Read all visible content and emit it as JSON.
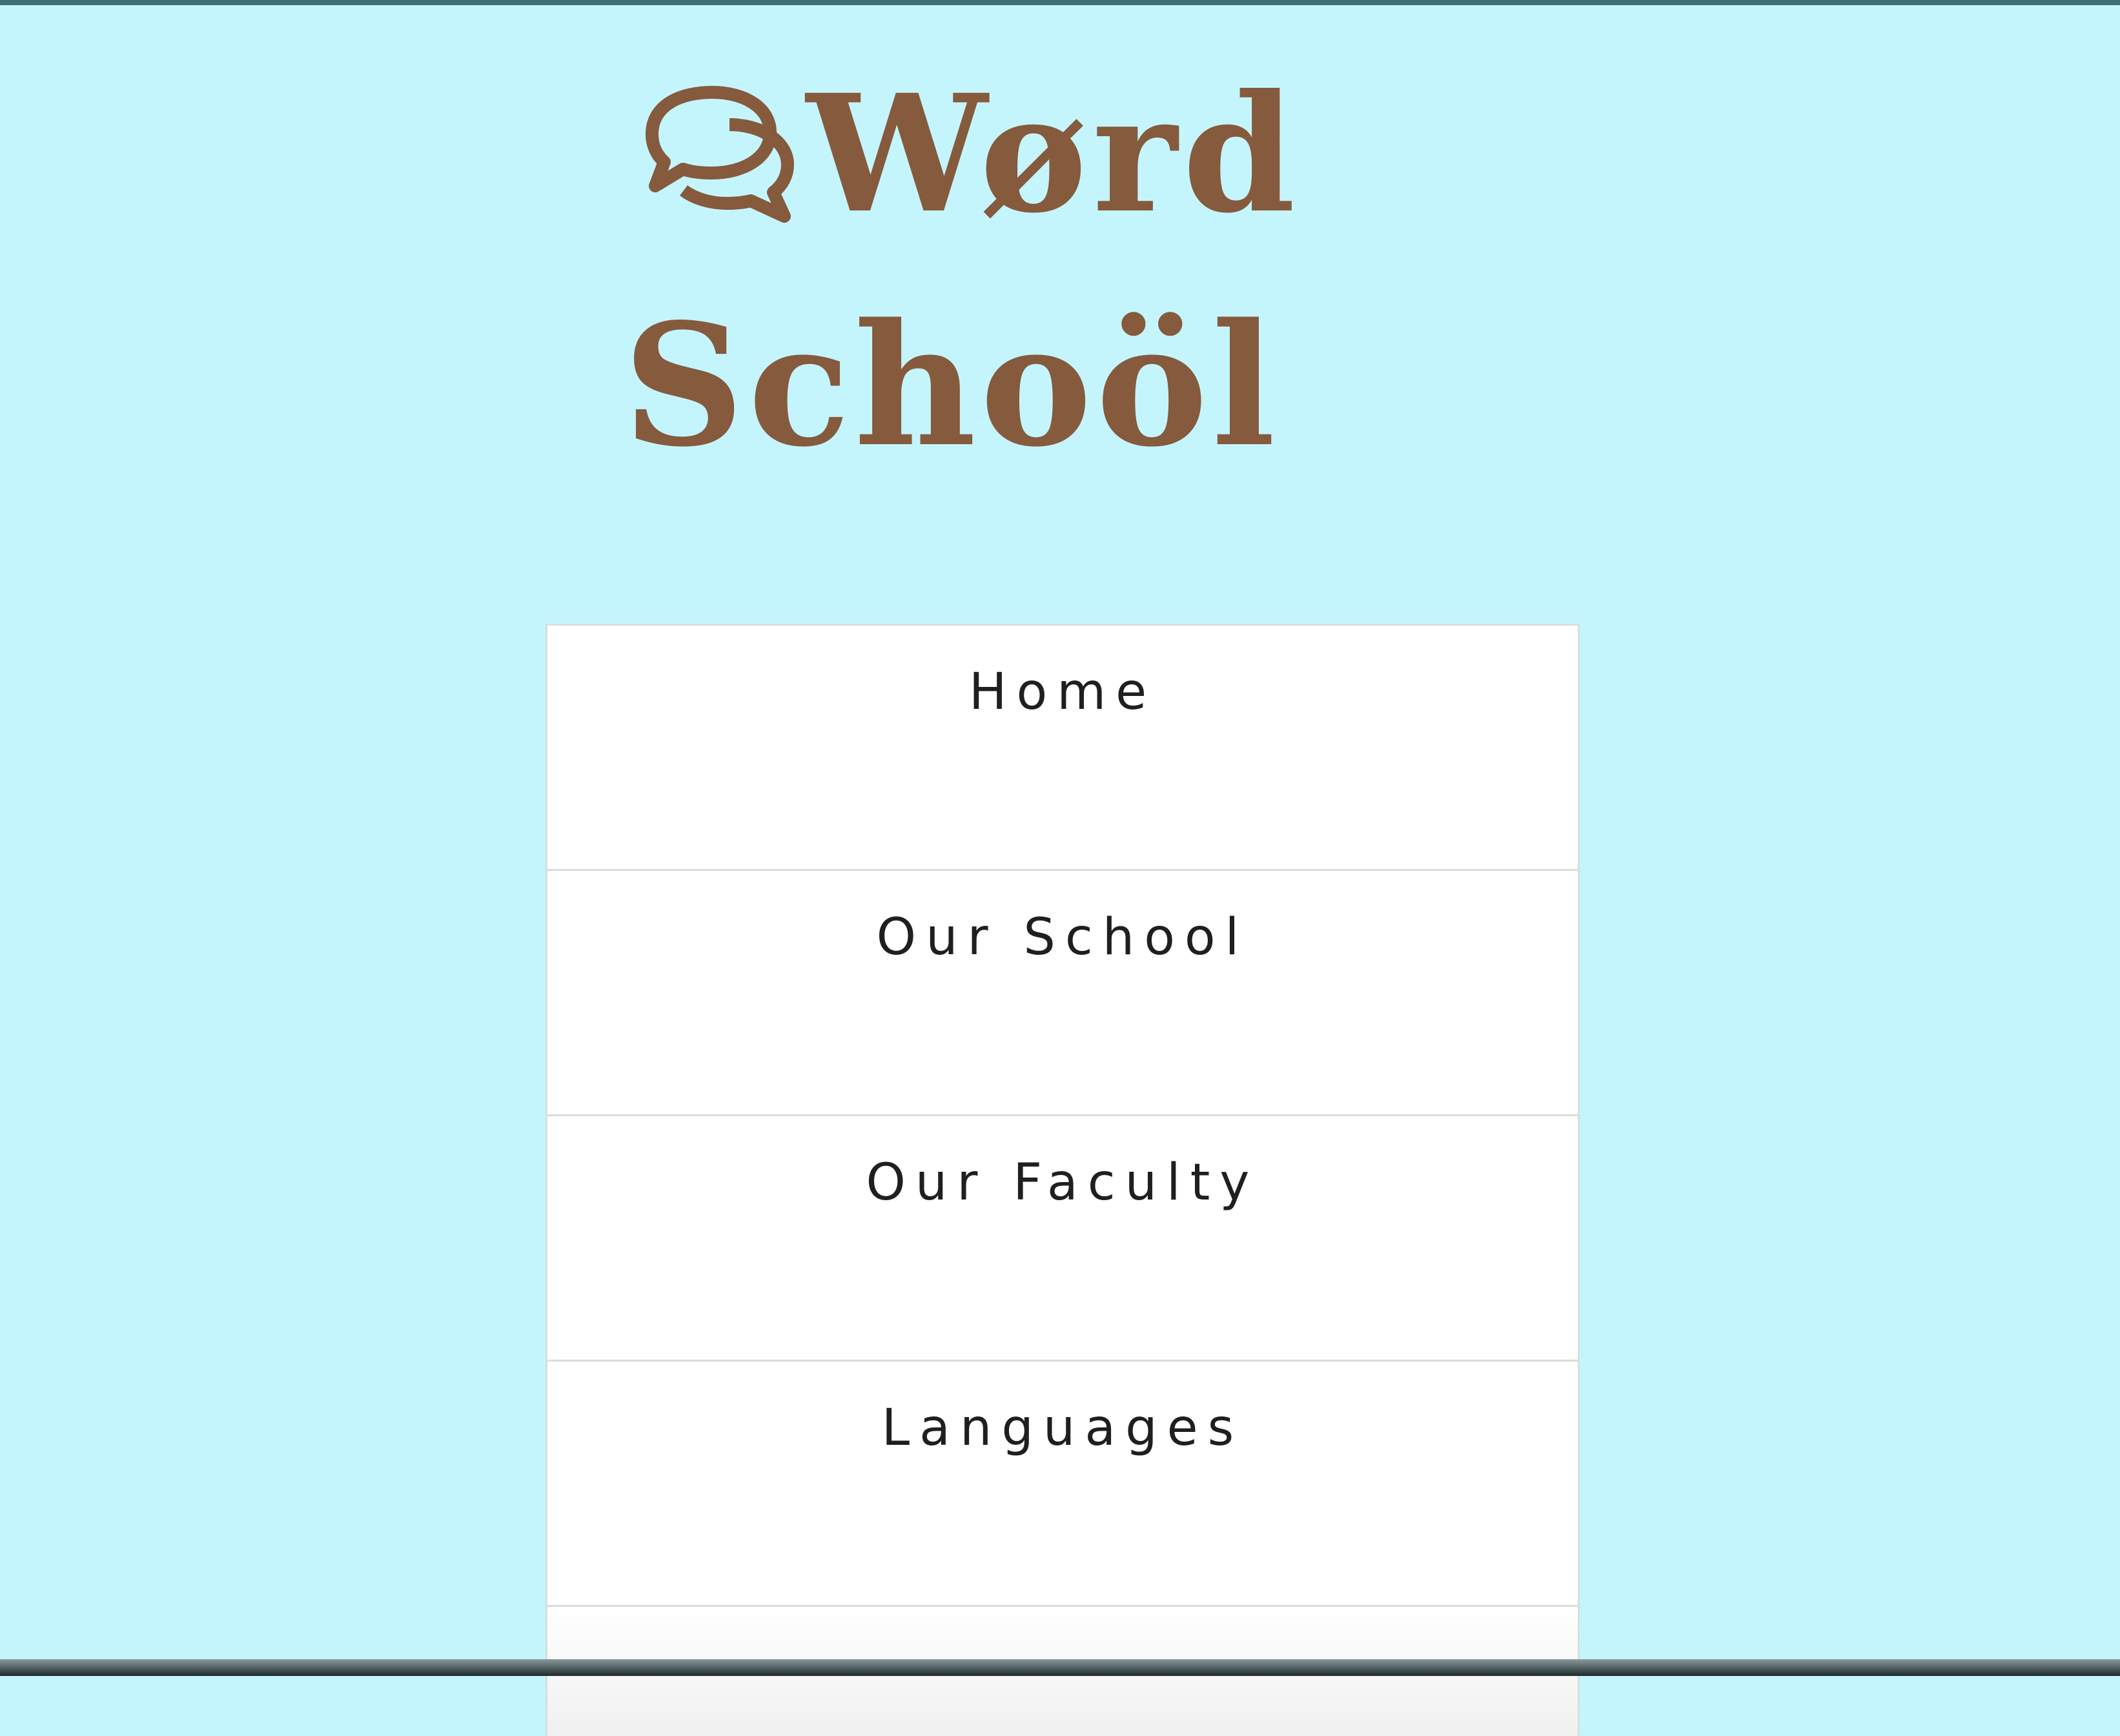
{
  "logo": {
    "icon": "speech-bubbles-icon",
    "line1": "Wørd",
    "line2": "Schoöl",
    "color": "#855a3d"
  },
  "nav": {
    "items": [
      {
        "label": "Home"
      },
      {
        "label": "Our School"
      },
      {
        "label": "Our Faculty"
      },
      {
        "label": "Languages"
      }
    ]
  },
  "colors": {
    "background": "#c5f5fc",
    "brand": "#855a3d",
    "menu_bg": "#ffffff",
    "menu_text": "#1f1f1f"
  }
}
